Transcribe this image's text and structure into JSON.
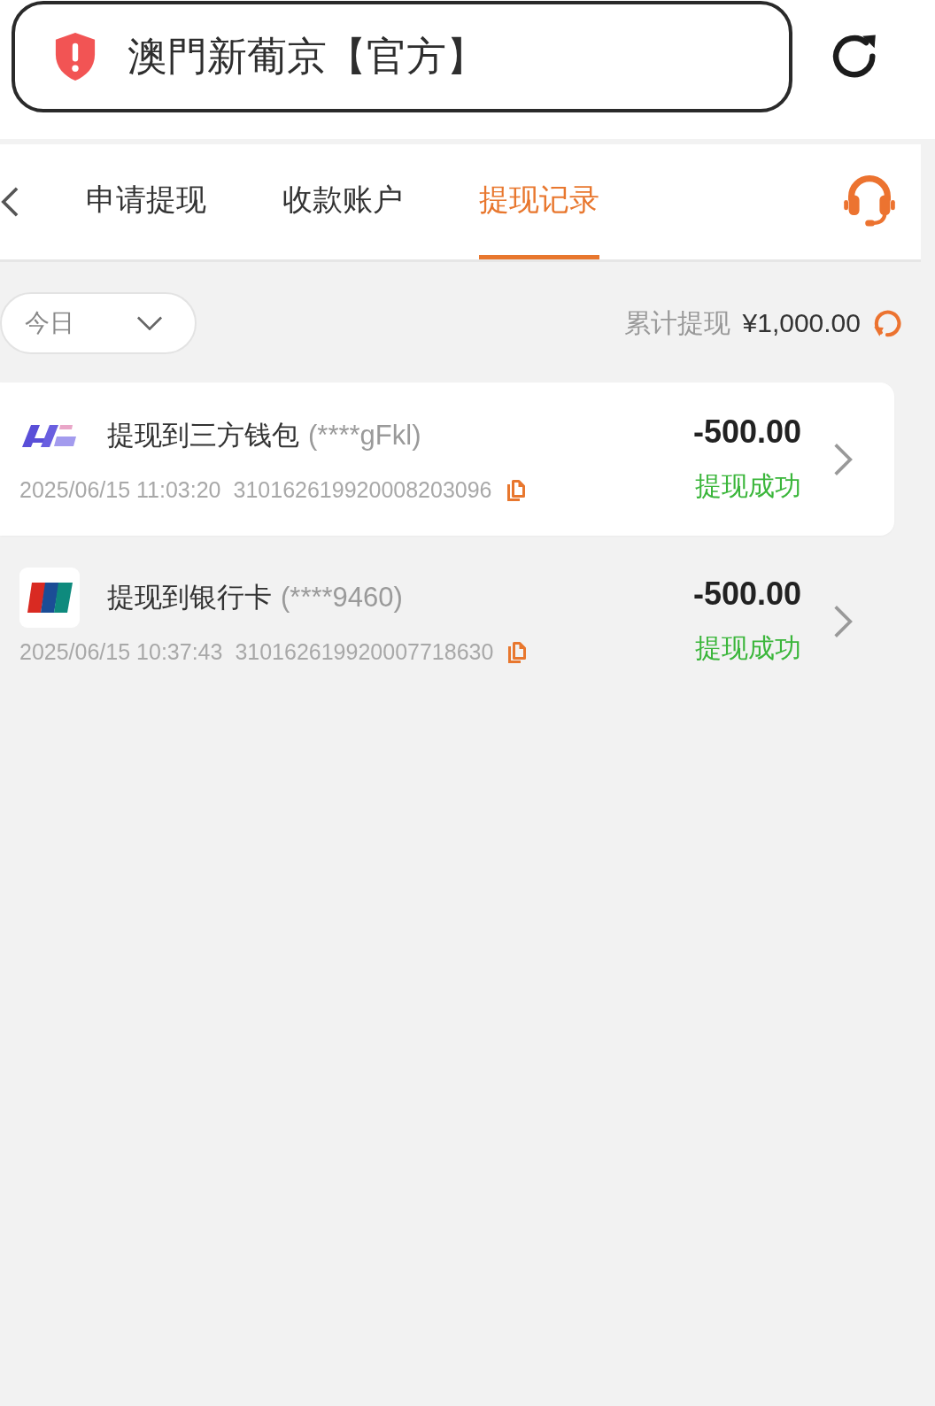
{
  "address_bar": {
    "title": "澳門新葡京【官方】"
  },
  "tabs": [
    {
      "label": "申请提现",
      "selected": false
    },
    {
      "label": "收款账户",
      "selected": false
    },
    {
      "label": "提现记录",
      "selected": true
    }
  ],
  "filter": {
    "period": "今日"
  },
  "summary": {
    "label": "累计提现",
    "amount": "¥1,000.00"
  },
  "records": [
    {
      "kind": "wallet",
      "selected": true,
      "title": "提现到三方钱包",
      "account": "(****gFkl)",
      "time": "2025/06/15 11:03:20",
      "order_no": "310162619920008203096",
      "amount": "-500.00",
      "status": "提现成功"
    },
    {
      "kind": "bank",
      "selected": false,
      "title": "提现到银行卡",
      "account": "(****9460)",
      "time": "2025/06/15 10:37:43",
      "order_no": "310162619920007718630",
      "amount": "-500.00",
      "status": "提现成功"
    }
  ]
}
